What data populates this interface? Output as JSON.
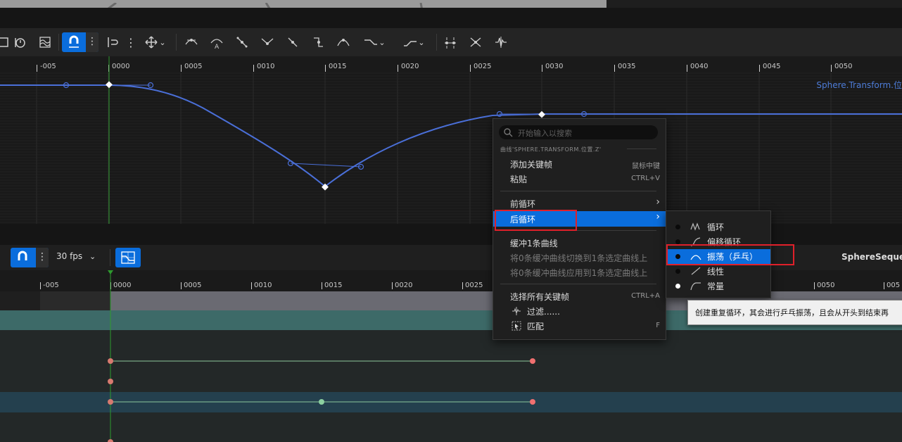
{
  "toolbar_top": {
    "icons": [
      "curve-view-icon",
      "time-icon",
      "normalize-icon",
      "snap-magnet-icon",
      "more-icon",
      "value-snap-icon",
      "more-icon",
      "transform-tool-icon",
      "auto-tangent-icon",
      "user-tangent-icon",
      "break-tangent-icon",
      "weighted-tangent-icon",
      "flatten-tangent-icon",
      "straighten-tangent-icon",
      "smart-tangent-icon",
      "pre-infinity-icon",
      "post-infinity-icon",
      "distribute-keys-icon",
      "filter-keys-icon",
      "euler-filter-icon"
    ]
  },
  "ruler_top": [
    "-005",
    "0000",
    "0005",
    "0010",
    "0015",
    "0020",
    "0025",
    "0030",
    "0035",
    "0040",
    "0045",
    "0050"
  ],
  "curve": {
    "name": "Sphere.Transform.位",
    "color": "#4a6fd8"
  },
  "toolbar_bottom": {
    "fps": "30 fps",
    "sequence_name": "SphereSequence"
  },
  "ruler_bottom": [
    "-005",
    "0000",
    "0005",
    "0010",
    "0015",
    "0020",
    "0025",
    "0050",
    "005"
  ],
  "context_menu": {
    "search_placeholder": "开始输入以搜索",
    "section_header": "曲线'SPHERE.TRANSFORM.位置.Z'",
    "add_key": "添加关键帧",
    "add_key_shortcut": "鼠标中键",
    "paste": "粘贴",
    "paste_shortcut": "CTRL+V",
    "pre_infinity": "前循环",
    "post_infinity": "后循环",
    "buffer_curve": "缓冲1条曲线",
    "swap_buffer": "将0条缓冲曲线切换到1条选定曲线上",
    "apply_buffer": "将0条缓冲曲线应用到1条选定曲线上",
    "select_all_keys": "选择所有关键帧",
    "select_all_shortcut": "CTRL+A",
    "filter": "过滤......",
    "match": "匹配",
    "match_shortcut": "F"
  },
  "submenu": {
    "items": [
      {
        "label": "循环",
        "icon": "cycle-icon"
      },
      {
        "label": "偏移循环",
        "icon": "offset-cycle-icon"
      },
      {
        "label": "振荡（乒乓）",
        "icon": "oscillate-icon"
      },
      {
        "label": "线性",
        "icon": "linear-icon"
      },
      {
        "label": "常量",
        "icon": "constant-icon"
      }
    ]
  },
  "tooltip": {
    "text": "创建重复循环，其会进行乒乓振荡，且会从开头到结束再"
  },
  "colors": {
    "accent": "#0a6ddc",
    "highlight_box": "#e0202a",
    "curve": "#4a6fd8",
    "key_red": "#e07070",
    "key_green": "#8cd0a0",
    "track_teal": "#3d6a68",
    "track_blue": "#24404e"
  }
}
